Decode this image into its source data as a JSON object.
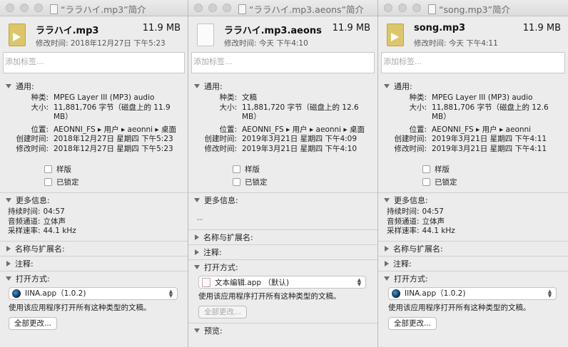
{
  "labels": {
    "tags_placeholder": "添加标签...",
    "general": "通用:",
    "kind": "种类:",
    "size": "大小:",
    "where": "位置:",
    "created": "创建时间:",
    "modified": "修改时间:",
    "stationery": "样版",
    "locked": "已锁定",
    "more_info": "更多信息:",
    "duration": "持续时间:",
    "channels": "音频通道:",
    "sample_rate": "采样速率:",
    "name_ext": "名称与扩展名:",
    "comments": "注释:",
    "open_with": "打开方式:",
    "open_with_desc": "使用该应用程序打开所有这种类型的文稿。",
    "change_all": "全部更改...",
    "preview": "预览:"
  },
  "windows": [
    {
      "title": "“ララハイ.mp3”简介",
      "filename": "ララハイ.mp3",
      "size": "11.9 MB",
      "modified_line": "修改时间:   2018年12月27日 下午5:23",
      "kind": "MPEG Layer III (MP3) audio",
      "size_detail": "11,881,706 字节（磁盘上的 11.9 MB）",
      "where": "AEONNI_FS ▸ 用户 ▸ aeonni ▸ 桌面",
      "created": "2018年12月27日 星期四 下午5:23",
      "modified": "2018年12月27日 星期四 下午5:23",
      "duration": "04:57",
      "channels": "立体声",
      "sample_rate": "44.1 kHz",
      "open_with_app": "IINA.app（1.0.2)"
    },
    {
      "title": "“ララハイ.mp3.aeons”简介",
      "filename": "ララハイ.mp3.aeons",
      "size": "11.9 MB",
      "modified_line": "修改时间:   今天 下午4:10",
      "kind": "文稿",
      "size_detail": "11,881,720 字节（磁盘上的 12.6 MB）",
      "where": "AEONNI_FS ▸ 用户 ▸ aeonni ▸ 桌面",
      "created": "2019年3月21日 星期四 下午4:09",
      "modified": "2019年3月21日 星期四 下午4:10",
      "more_info_value": "--",
      "open_with_app": "文本编辑.app （默认)"
    },
    {
      "title": "“song.mp3”简介",
      "filename": "song.mp3",
      "size": "11.9 MB",
      "modified_line": "修改时间:   今天 下午4:11",
      "kind": "MPEG Layer III (MP3) audio",
      "size_detail": "11,881,706 字节（磁盘上的 12.6 MB）",
      "where": "AEONNI_FS ▸ 用户 ▸ aeonni",
      "created": "2019年3月21日 星期四 下午4:11",
      "modified": "2019年3月21日 星期四 下午4:11",
      "duration": "04:57",
      "channels": "立体声",
      "sample_rate": "44.1 kHz",
      "open_with_app": "IINA.app（1.0.2)"
    }
  ]
}
